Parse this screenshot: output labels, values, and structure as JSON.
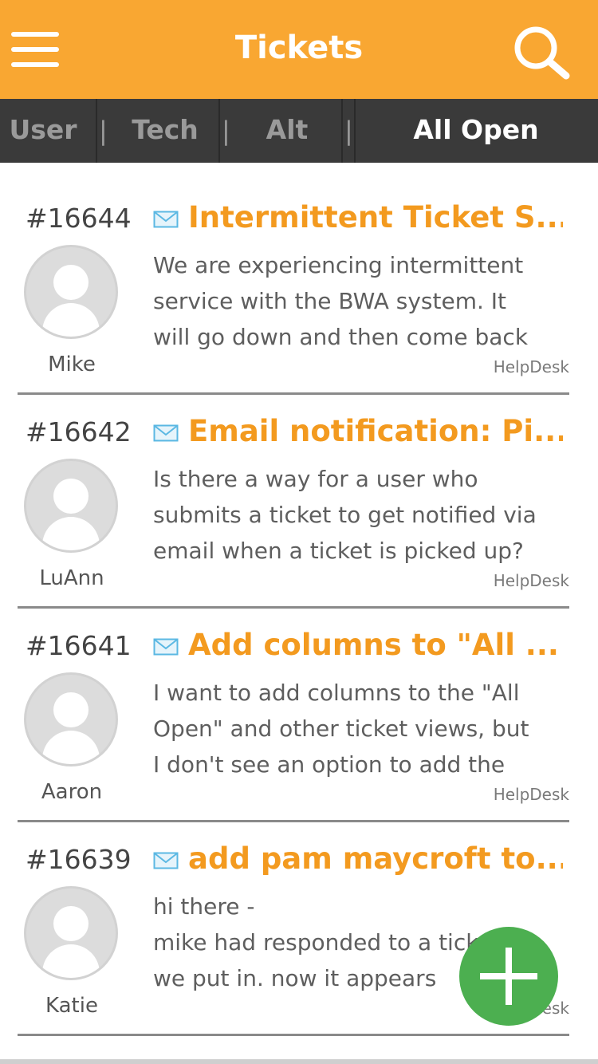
{
  "header": {
    "title": "Tickets",
    "menu_icon": "hamburger-menu-icon",
    "search_icon": "search-icon",
    "accent_color": "#f9a732"
  },
  "tabs": {
    "items": [
      {
        "label": "User",
        "active": false
      },
      {
        "label": "Tech",
        "active": false
      },
      {
        "label": "Alt",
        "active": false
      },
      {
        "label": "All Open",
        "active": true
      }
    ],
    "separator": "|"
  },
  "tickets": [
    {
      "number": "#16644",
      "title": "Intermittent Ticket S...",
      "author": "Mike",
      "source": "HelpDesk",
      "body": [
        "We are experiencing intermittent",
        "service with the BWA system. It",
        "will go down and then come back"
      ]
    },
    {
      "number": "#16642",
      "title": "Email notification: Pi...",
      "author": "LuAnn",
      "source": "HelpDesk",
      "body": [
        "Is there a way for a user who",
        "submits a ticket to get notified via",
        "email when a ticket is picked up?"
      ]
    },
    {
      "number": "#16641",
      "title": "Add columns to \"All ...",
      "author": "Aaron",
      "source": "HelpDesk",
      "body": [
        "I want to add columns to the \"All",
        "Open\" and other ticket views, but",
        "I don't see an option to add the"
      ]
    },
    {
      "number": "#16639",
      "title": "add pam maycroft to...",
      "author": "Katie",
      "source": "HelpDesk",
      "body": [
        "hi there -",
        "mike had responded to a ticket",
        "we put in. now it appears"
      ]
    }
  ],
  "fab": {
    "icon": "plus-icon",
    "color": "#4caf50"
  }
}
